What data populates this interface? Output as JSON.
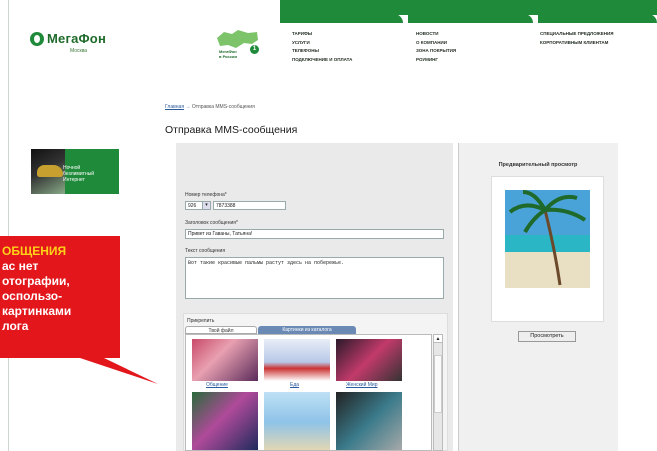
{
  "logo": {
    "name": "МегаФон",
    "region": "Москва"
  },
  "map_badge": {
    "line1": "МегаФон",
    "line2": "в России",
    "number": "1"
  },
  "nav": [
    [
      "Тарифы",
      "Услуги",
      "Телефоны",
      "Подключение и оплата"
    ],
    [
      "Новости",
      "О компании",
      "Зона покрытия",
      "Роуминг"
    ],
    [
      "Специальные предложения",
      "Корпоративным клиентам"
    ]
  ],
  "breadcrumb": {
    "home": "Главная",
    "separator": "→",
    "current": "Отправка MMS-сообщения"
  },
  "page_title": "Отправка MMS-сообщения",
  "promo": {
    "text": "Ночной\nбезлимитный\nИнтернет"
  },
  "form": {
    "phone_label": "Номер телефона*",
    "phone_code": "926",
    "phone_number": "7873388",
    "subject_label": "Заголовок сообщения*",
    "subject_value": "Привет из Гаваны, Татьяна!",
    "message_label": "Текст сообщения",
    "message_value": "Вот такие красивые пальмы растут здесь на побережье.",
    "attach_label": "Прикрепить",
    "tab_own": "Твой файл",
    "tab_catalog": "Картинки из каталога"
  },
  "gallery": {
    "captions": [
      "Общение",
      "Еда",
      "Женский Мир"
    ]
  },
  "preview": {
    "title": "Предварительный просмотр",
    "button": "Просмотреть"
  },
  "callout": {
    "line1": "ОБЩЕНИЯ",
    "lines": "ас нет\nотографии,\nоспользо-\nкартинками\nлога"
  },
  "colors": {
    "brand_green": "#1e8a3a",
    "callout_red": "#e3161b",
    "callout_yellow": "#ffd21a",
    "tab_blue": "#6a8ab5"
  }
}
